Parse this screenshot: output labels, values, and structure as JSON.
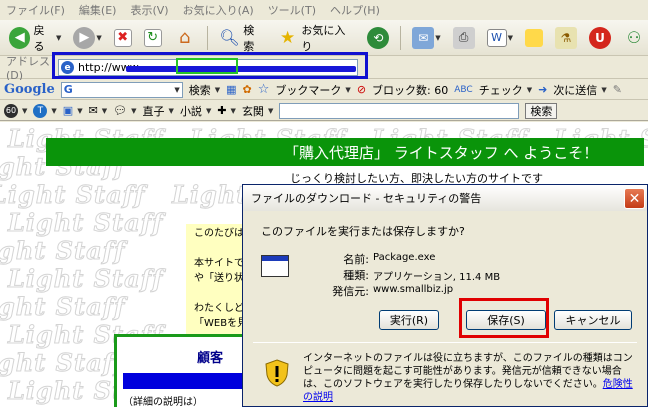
{
  "menu": [
    "ファイル(F)",
    "編集(E)",
    "表示(V)",
    "お気に入り(A)",
    "ツール(T)",
    "ヘルプ(H)"
  ],
  "toolbar": {
    "back_label": "戻る",
    "search_label": "検索",
    "favorites_label": "お気に入り"
  },
  "address": {
    "label": "アドレス(D)",
    "url": "http://www."
  },
  "google": {
    "logo": "Google",
    "g_letter": "G",
    "search_label": "検索",
    "bookmark_label": "ブックマーク",
    "blocked_label": "ブロック数: 60",
    "check_label": "チェック",
    "send_label": "次に送信"
  },
  "linksbar": {
    "item1": "直子",
    "item2": "小説",
    "item3": "玄関",
    "search_button": "検索"
  },
  "page": {
    "watermark": "Light Staff",
    "banner": "「購入代理店」 ライトスタッフ へ ようこそ！",
    "subtitle": "じっくり検討したい方、即決したい方のサイトです",
    "yellow_lines": [
      "このたびは",
      "",
      "本サイトで",
      "や「送り状",
      "",
      "わたくしど",
      "「WEBを見"
    ],
    "box_title": "顧客",
    "box_desc": "（詳細の説明は）"
  },
  "dialog": {
    "title": "ファイルのダウンロード - セキュリティの警告",
    "question": "このファイルを実行または保存しますか?",
    "name_label": "名前:",
    "name_value": "Package.exe",
    "type_label": "種類:",
    "type_value": "アプリケーション, 11.4 MB",
    "from_label": "発信元:",
    "from_value": "www.smallbiz.jp",
    "run_button": "実行(R)",
    "save_button": "保存(S)",
    "cancel_button": "キャンセル",
    "warning_text": "インターネットのファイルは役に立ちますが、このファイルの種類はコンピュータに問題を起こす可能性があります。発信元が信頼できない場合は、このソフトウェアを実行したり保存したりしないでください。",
    "risk_link": "危険性の説明"
  },
  "icons": {
    "back": "back-arrow-icon",
    "forward": "forward-arrow-icon",
    "stop": "stop-icon",
    "refresh": "refresh-icon",
    "home": "home-icon",
    "search": "search-icon",
    "favorites": "star-icon",
    "history": "history-icon",
    "warning": "shield-warning-icon"
  }
}
